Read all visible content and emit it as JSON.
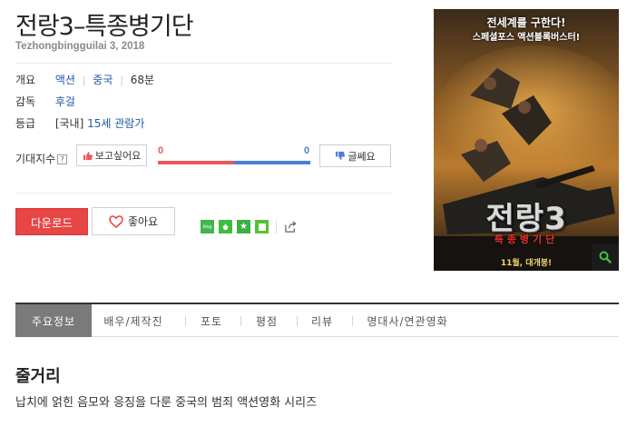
{
  "movie": {
    "title": "전랑3–특종병기단",
    "subtitle": "Tezhongbingguilai 3, 2018"
  },
  "info": {
    "overview_label": "개요",
    "genre": "액션",
    "country": "중국",
    "runtime": "68분",
    "director_label": "감독",
    "director": "후걸",
    "rating_label": "등급",
    "rating_prefix": "[국내]",
    "rating": "15세 관람가"
  },
  "expectation": {
    "label": "기대지수",
    "help": "?",
    "want_label": "보고싶어요",
    "want_count": "0",
    "meh_count": "0",
    "meh_label": "글쎄요",
    "want_share": 0.5
  },
  "actions": {
    "download_label": "다운로드",
    "like_label": "좋아요",
    "blog_label": "blog"
  },
  "poster": {
    "tagline_1": "전세계를 구한다!",
    "tagline_2": "스페셜포스 액션블록버스터!",
    "poster_title": "전랑3",
    "poster_subtitle": "특종병기단",
    "release": "11월, 대개봉!"
  },
  "tabs": [
    {
      "label": "주요정보"
    },
    {
      "label": "배우/제작진"
    },
    {
      "label": "포토"
    },
    {
      "label": "평점"
    },
    {
      "label": "리뷰"
    },
    {
      "label": "명대사/연관영화"
    }
  ],
  "plot": {
    "heading": "줄거리",
    "text": "납치에 얽힌 음모와 응징을 다룬 중국의 범죄 액션영화 시리즈"
  },
  "colors": {
    "download": "#e84545",
    "want": "#e85a5a",
    "meh": "#4a7fd6",
    "link": "#1e5aa8"
  }
}
